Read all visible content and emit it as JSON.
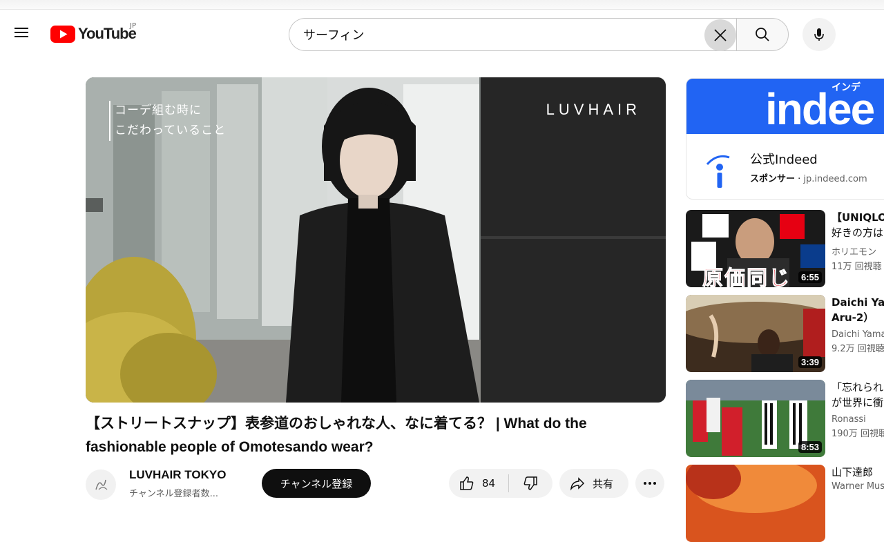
{
  "masthead": {
    "logo_text": "YouTube",
    "country_code": "JP",
    "search_value": "サーフィン"
  },
  "player": {
    "overlay_line1": "コーデ組む時に",
    "overlay_line2": "こだわっていること",
    "overlay_brand": "LUVHAIR"
  },
  "video": {
    "title": "【ストリートスナップ】表参道のおしゃれな人、なに着てる？ | What do the fashionable people of Omotesando wear?",
    "channel_name": "LUVHAIR TOKYO",
    "subscribers": "チャンネル登録者数...",
    "subscribe_label": "チャンネル登録",
    "like_count": "84",
    "share_label": "共有"
  },
  "ad": {
    "banner_text": "indee",
    "banner_sub": "インデ",
    "title": "公式Indeed",
    "sponsor_label": "スポンサー",
    "separator": " · ",
    "domain": "jp.indeed.com"
  },
  "recommendations": [
    {
      "title_line1": "【UNIQLO",
      "title_line2": "好きの方は",
      "channel": "ホリエモン",
      "views": "11万 回視聴",
      "duration": "6:55",
      "thumb_text": "原価同じ"
    },
    {
      "title_line1": "Daichi Yam",
      "title_line2": "Aru-2）",
      "channel": "Daichi Yama",
      "views": "9.2万 回視聴",
      "duration": "3:39"
    },
    {
      "title_line1": "「忘れられ",
      "title_line2": "が世界に衝",
      "channel": "Ronassi",
      "views": "190万 回視聴",
      "duration": "8:53"
    },
    {
      "title_line1": "山下達郎",
      "title_line2": "",
      "channel": "Warner Mus",
      "views": "",
      "duration": ""
    }
  ],
  "colors": {
    "brand_red": "#ff0000",
    "indeed_blue": "#2164f3",
    "subscribe_bg": "#0f0f0f"
  }
}
